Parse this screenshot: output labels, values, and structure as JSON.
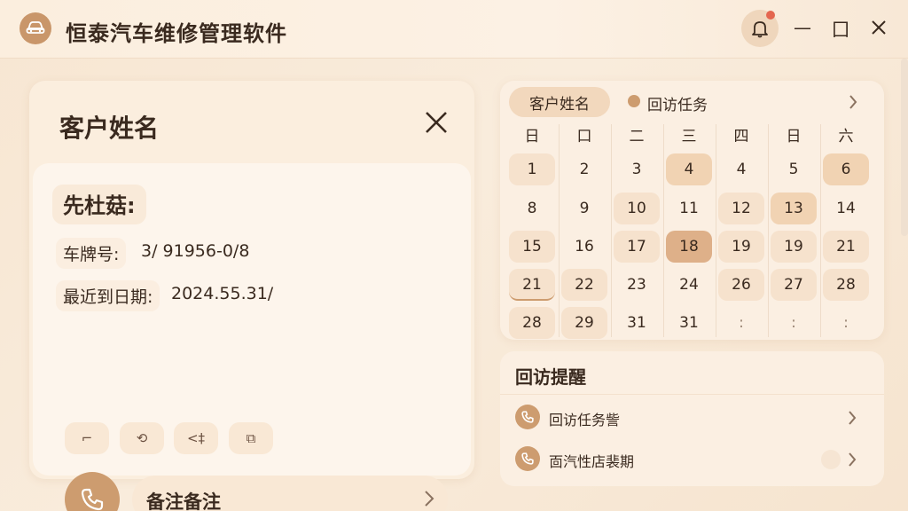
{
  "app": {
    "title": "恒泰汽车维修管理软件",
    "icons": {
      "logo": "car-icon",
      "bell": "bell-icon",
      "minimize": "minimize-icon",
      "maximize": "restore-icon",
      "close": "close-icon"
    },
    "window_controls": {
      "minimize": "—",
      "maximize": "囗"
    }
  },
  "customer_card": {
    "title": "客户姓名",
    "name": "先杜菇:",
    "plate_label": "车牌号:",
    "plate_value": "3/ 91956-0/8",
    "date_label": "最近到日期:",
    "date_value": "2024.55.31/",
    "actions": [
      {
        "glyph": "⌐",
        "icon": "undo-icon"
      },
      {
        "glyph": "⟲",
        "icon": "edit-icon"
      },
      {
        "glyph": "<‡",
        "icon": "transfer-icon"
      },
      {
        "glyph": "⧉",
        "icon": "copy-icon"
      }
    ],
    "note": "备注备注"
  },
  "calendar": {
    "tab_label": "客户姓名",
    "legend_label": "回访任务",
    "weekdays": [
      "日",
      "口",
      "二",
      "三",
      "四",
      "日",
      "六"
    ],
    "rows": [
      [
        "1",
        "2",
        "3",
        "4",
        "4",
        "5",
        "6"
      ],
      [
        "8",
        "9",
        "10",
        "11",
        "12",
        "13",
        "14"
      ],
      [
        "15",
        "16",
        "17",
        "18",
        "19",
        "19",
        "21"
      ],
      [
        "21",
        "22",
        "23",
        "24",
        "26",
        "27",
        "28"
      ],
      [
        "28",
        "29",
        "31",
        "31",
        ":",
        ":",
        ":"
      ]
    ],
    "highlight_colors": {
      "soft": "#f6e2cd",
      "mid": "#f1d3b3",
      "strong": "#deb089"
    }
  },
  "reminders": {
    "title": "回访提醒",
    "items": [
      {
        "label": "回访任务訾",
        "icon": "phone-icon"
      },
      {
        "label": "靣汽性店裴期",
        "icon": "phone-icon"
      }
    ]
  },
  "colors": {
    "accent": "#cd9c6f",
    "notification": "#e4664f",
    "background": "#f7e6d2"
  }
}
